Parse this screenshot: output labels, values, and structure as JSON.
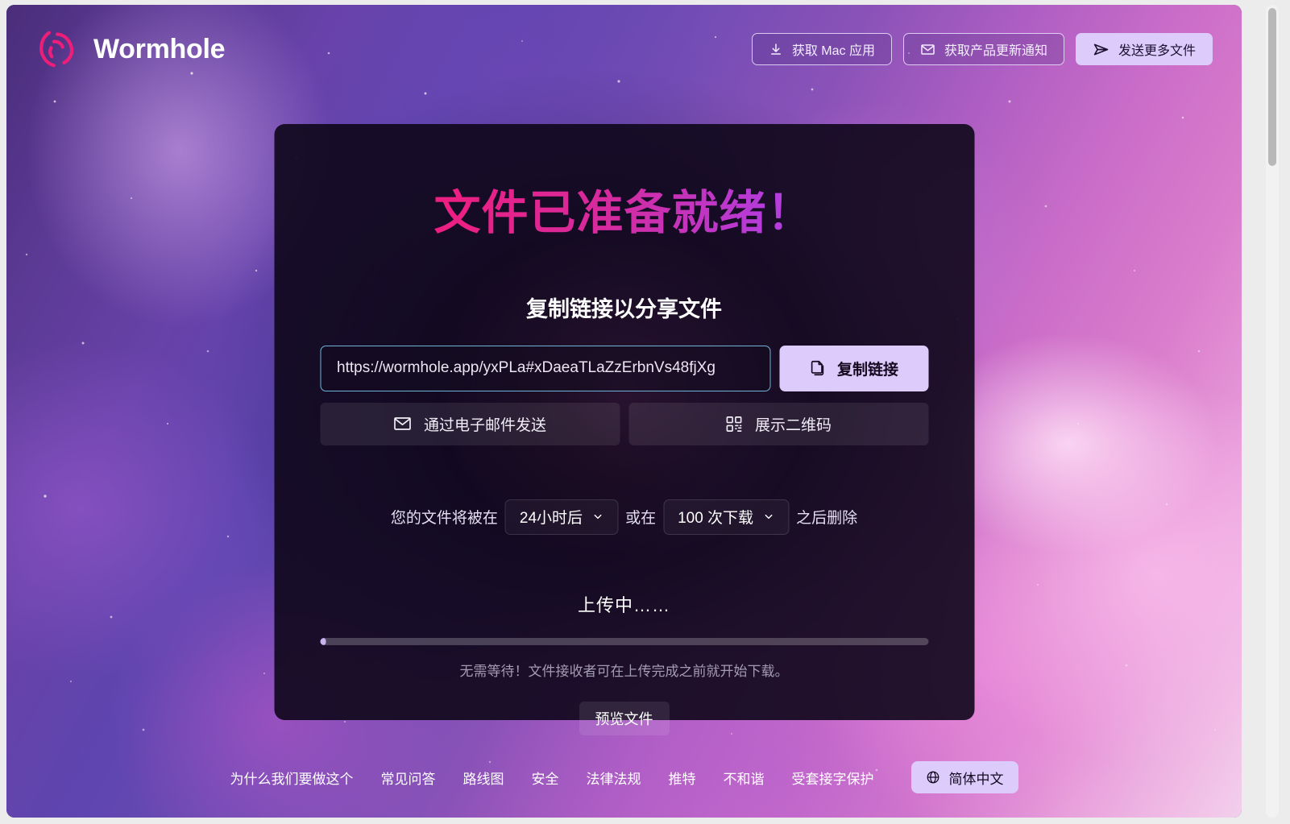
{
  "brand": {
    "name": "Wormhole",
    "logo_icon": "wormhole-spiral-icon"
  },
  "header": {
    "buttons": [
      {
        "label": "获取 Mac 应用",
        "icon": "download-icon",
        "style": "outline"
      },
      {
        "label": "获取产品更新通知",
        "icon": "envelope-icon",
        "style": "outline"
      },
      {
        "label": "发送更多文件",
        "icon": "send-paper-plane-icon",
        "style": "solid"
      }
    ]
  },
  "card": {
    "title": "文件已准备就绪！",
    "subtitle": "复制链接以分享文件",
    "share_link": {
      "value": "https://wormhole.app/yxPLa#xDaeaTLaZzErbnVs48fjXg",
      "placeholder": "https://wormhole.app/",
      "copy_label": "复制链接",
      "copy_icon": "copy-documents-icon"
    },
    "share_buttons": [
      {
        "label": "通过电子邮件发送",
        "icon": "envelope-icon"
      },
      {
        "label": "展示二维码",
        "icon": "qr-code-icon"
      }
    ],
    "expiry": {
      "prefix": "您的文件将被在",
      "time_value": "24小时后",
      "middle": "或在",
      "downloads_value": "100 次下载",
      "suffix": "之后删除",
      "chevron_icon": "chevron-down-icon"
    },
    "upload": {
      "status": "上传中……",
      "percent": 1,
      "hint": "无需等待！文件接收者可在上传完成之前就开始下载。"
    }
  },
  "preview": {
    "label": "预览文件"
  },
  "footer": {
    "links": [
      "为什么我们要做这个",
      "常见问答",
      "路线图",
      "安全",
      "法律法规",
      "推特",
      "不和谐",
      "受套接字保护"
    ],
    "language": {
      "label": "简体中文",
      "icon": "globe-icon"
    }
  },
  "colors": {
    "accent_pink": "#ec1f82",
    "accent_purple": "#a34cf5",
    "button_lavender": "#ddcbfb",
    "input_focus_border": "#6fb4d8",
    "progress_fill": "#c9b4f0"
  }
}
